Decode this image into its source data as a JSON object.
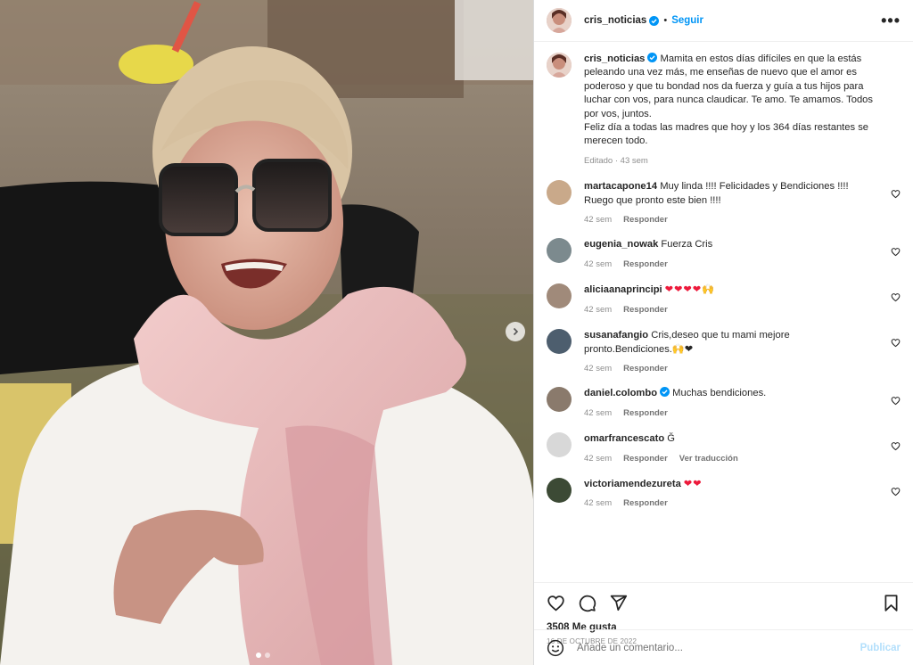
{
  "post": {
    "username": "cris_noticias",
    "follow_label": "Seguir",
    "separator": "•",
    "more_label": "•••",
    "caption_lines": [
      "Mamita en estos días difíciles en que la estás",
      "peleando una vez más, me enseñas de nuevo que el amor es",
      "poderoso y que tu bondad nos da fuerza y guía a tus hijos para",
      "luchar con vos, para nunca claudicar. Te amo. Te amamos. Todos",
      "por vos, juntos.",
      "Feliz día a todas las madres que hoy y los 364 días restantes se",
      "merecen todo."
    ],
    "caption_meta": "Editado · 43 sem",
    "likes": "3508 Me gusta",
    "date": "16 DE OCTUBRE DE 2022",
    "carousel": {
      "count": 2,
      "active_index": 0
    }
  },
  "comments": [
    {
      "user": "martacapone14",
      "lines": [
        "Muy linda !!!! Felicidades y Bendiciones !!!!",
        "Ruego que pronto este bien !!!!"
      ],
      "time": "42 sem",
      "reply": "Responder",
      "avatar_color": "#c9a98a"
    },
    {
      "user": "eugenia_nowak",
      "lines": [
        "Fuerza Cris"
      ],
      "time": "42 sem",
      "reply": "Responder",
      "avatar_color": "#7c8a8e"
    },
    {
      "user": "aliciaanaprincipi",
      "lines": [
        "❤❤❤❤🙌"
      ],
      "time": "42 sem",
      "reply": "Responder",
      "avatar_color": "#a08a7a",
      "emoji": true
    },
    {
      "user": "susanafangio",
      "lines": [
        "Cris,deseo que tu mami mejore",
        "pronto.Bendiciones.🙌❤"
      ],
      "time": "42 sem",
      "reply": "Responder",
      "avatar_color": "#4d5e6e"
    },
    {
      "user": "daniel.colombo",
      "verified": true,
      "lines": [
        "Muchas bendiciones."
      ],
      "time": "42 sem",
      "reply": "Responder",
      "avatar_color": "#8a7a6c"
    },
    {
      "user": "omarfrancescato",
      "lines": [
        "Ğ"
      ],
      "time": "42 sem",
      "reply": "Responder",
      "translate": "Ver traducción",
      "avatar_color": "#d8d8d8"
    },
    {
      "user": "victoriamendezureta",
      "lines": [
        "❤❤"
      ],
      "time": "42 sem",
      "reply": "Responder",
      "avatar_color": "#3c4a35",
      "emoji": true
    }
  ],
  "add_comment": {
    "placeholder": "Añade un comentario...",
    "publish": "Publicar"
  },
  "icons": {
    "verified": "verified-badge-icon",
    "like": "heart-icon",
    "comment": "comment-icon",
    "share": "paper-plane-icon",
    "save": "bookmark-icon",
    "emoji": "smiley-icon",
    "next": "chevron-right-icon"
  },
  "colors": {
    "accent": "#0095f6",
    "heart": "#ed1a3b",
    "muted": "#8e8e8e",
    "publish_disabled": "#b2dffc"
  }
}
